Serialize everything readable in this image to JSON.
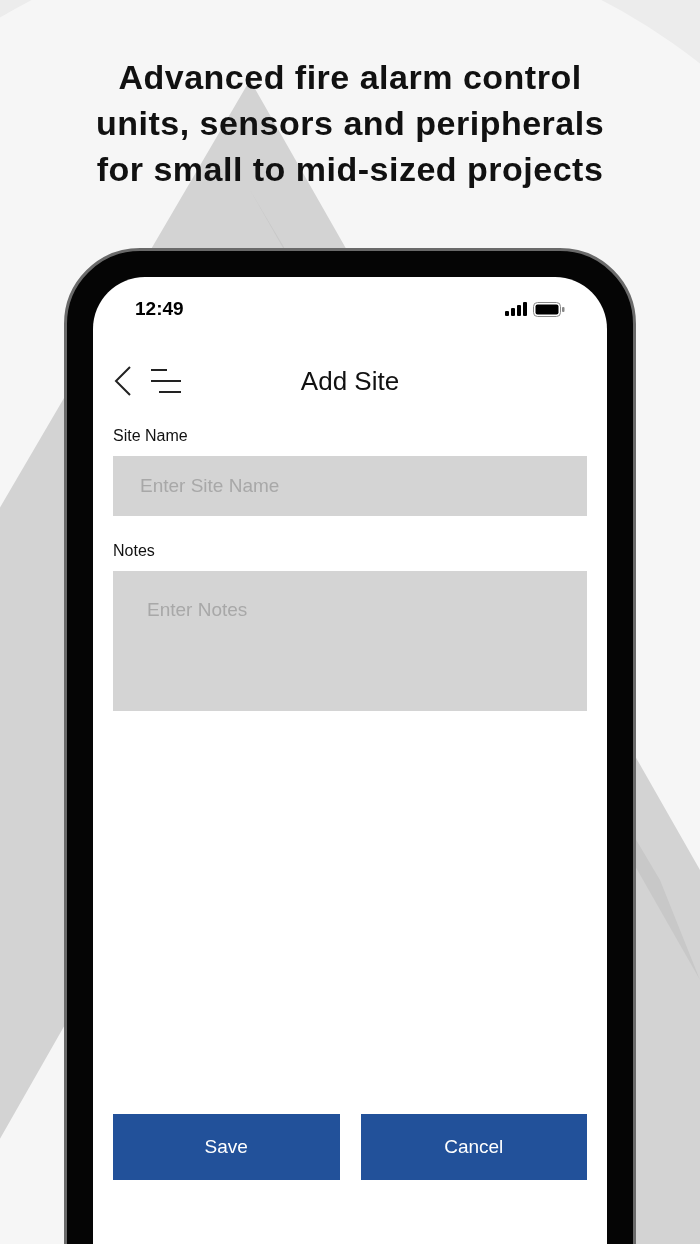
{
  "headline": "Advanced fire alarm control units, sensors and peripherals for small to mid-sized projects",
  "status_bar": {
    "time": "12:49"
  },
  "header": {
    "title": "Add Site"
  },
  "fields": [
    {
      "label": "Site Name",
      "placeholder": "Enter Site Name",
      "kind": "input"
    },
    {
      "label": "Notes",
      "placeholder": "Enter Notes",
      "kind": "textarea"
    }
  ],
  "buttons": [
    "Save",
    "Cancel"
  ]
}
